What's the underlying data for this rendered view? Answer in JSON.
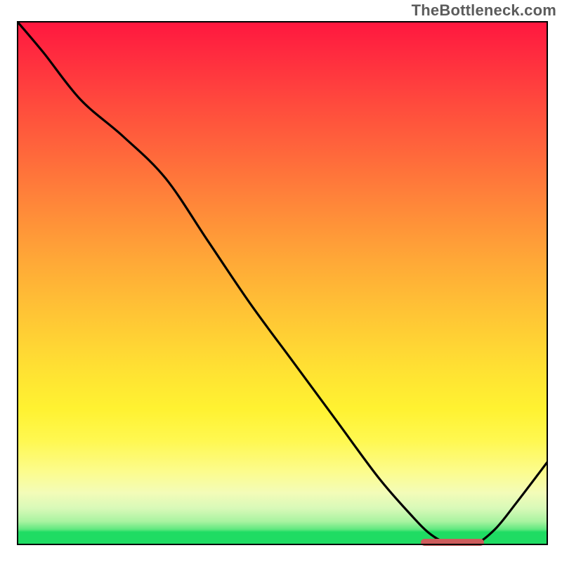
{
  "watermark": "TheBottleneck.com",
  "colors": {
    "curve": "#000000",
    "marker": "#cd5c5c",
    "border": "#000000"
  },
  "chart_data": {
    "type": "line",
    "title": "",
    "xlabel": "",
    "ylabel": "",
    "xlim": [
      0,
      100
    ],
    "ylim": [
      0,
      100
    ],
    "grid": false,
    "legend": false,
    "series": [
      {
        "name": "curve",
        "x": [
          0,
          5,
          12,
          20,
          28,
          36,
          44,
          52,
          60,
          68,
          74,
          78,
          82,
          86,
          90,
          94,
          100
        ],
        "y": [
          100,
          94,
          85,
          78,
          70,
          58,
          46,
          35,
          24,
          13,
          6,
          2,
          0,
          0,
          3,
          8,
          16
        ]
      }
    ],
    "marker": {
      "x_start": 76,
      "x_end": 88,
      "y": 0.6,
      "note": "flat-bottom optimal region indicator"
    },
    "background_gradient_stops": [
      {
        "pos": 0.0,
        "color": "#ff173f"
      },
      {
        "pos": 0.36,
        "color": "#ff8a39"
      },
      {
        "pos": 0.66,
        "color": "#ffe033"
      },
      {
        "pos": 0.86,
        "color": "#fcfc8d"
      },
      {
        "pos": 0.97,
        "color": "#5fe87f"
      },
      {
        "pos": 1.0,
        "color": "#1fdc63"
      }
    ]
  }
}
